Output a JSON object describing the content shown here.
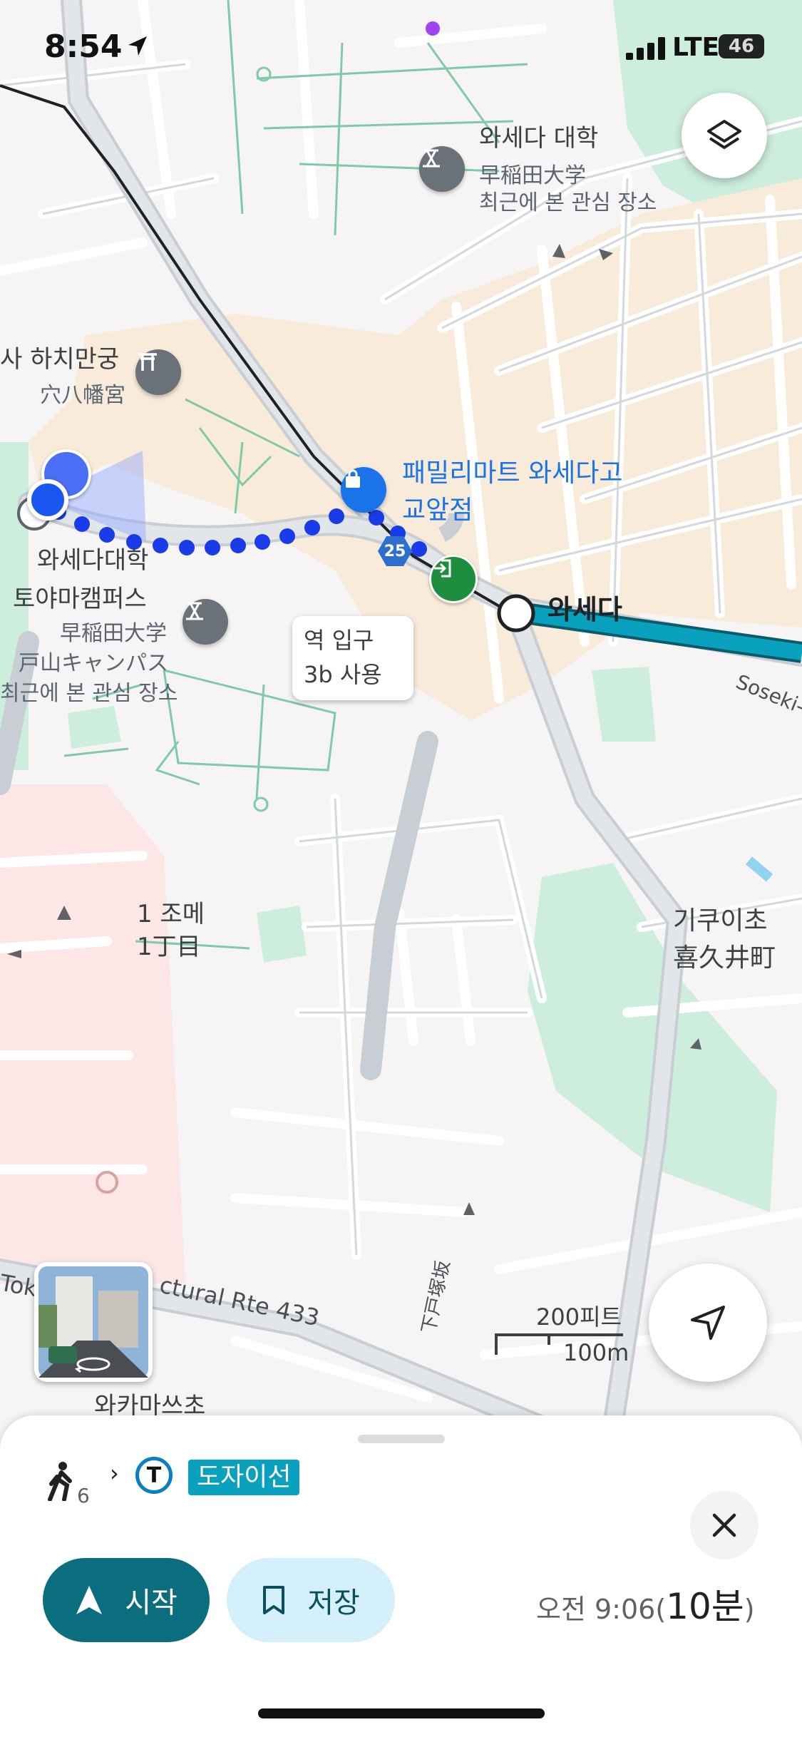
{
  "status_bar": {
    "time": "8:54",
    "network": "LTE",
    "battery": "46"
  },
  "map_labels": {
    "waseda_univ_ko": "와세다 대학",
    "waseda_univ_ja": "早稲田大学",
    "waseda_univ_recent": "최근에 본 관심 장소",
    "hachiman_ko": "사 하치만궁",
    "hachiman_ja": "穴八幡宮",
    "familymart_line1": "패밀리마트 와세다고",
    "familymart_line2": "교앞점",
    "route_number": "25",
    "station_name": "와세다",
    "toyama_line1": "와세다대학",
    "toyama_line2": "토야마캠퍼스",
    "toyama_ja1": "早稲田大学",
    "toyama_ja2": "戸山キャンパス",
    "toyama_recent": "최근에 본 관심 장소",
    "entrance_line1": "역 입구",
    "entrance_line2": "3b 사용",
    "soseki": "Soseki-",
    "chome_ko": "1 조메",
    "chome_ja": "1丁目",
    "kikuicho_ko": "기쿠이초",
    "kikuicho_ja": "喜久井町",
    "route433_left": "Tok",
    "route433_right": "ctural Rte 433",
    "shimotozuka": "下戸塚坂",
    "wakamatsu": "와카마쓰초",
    "scale_ft": "200피트",
    "scale_m": "100m"
  },
  "sheet": {
    "walk_minutes": "6",
    "line_name": "도자이선",
    "start_label": "시작",
    "save_label": "저장",
    "arrival_time": "오전 9:06(",
    "duration": "10분",
    "duration_close": ")"
  },
  "colors": {
    "walk_dots": "#1a3be8",
    "tozai_line": "#0097b2",
    "start_button": "#0b6e7f",
    "save_button": "#d4f1fb"
  }
}
